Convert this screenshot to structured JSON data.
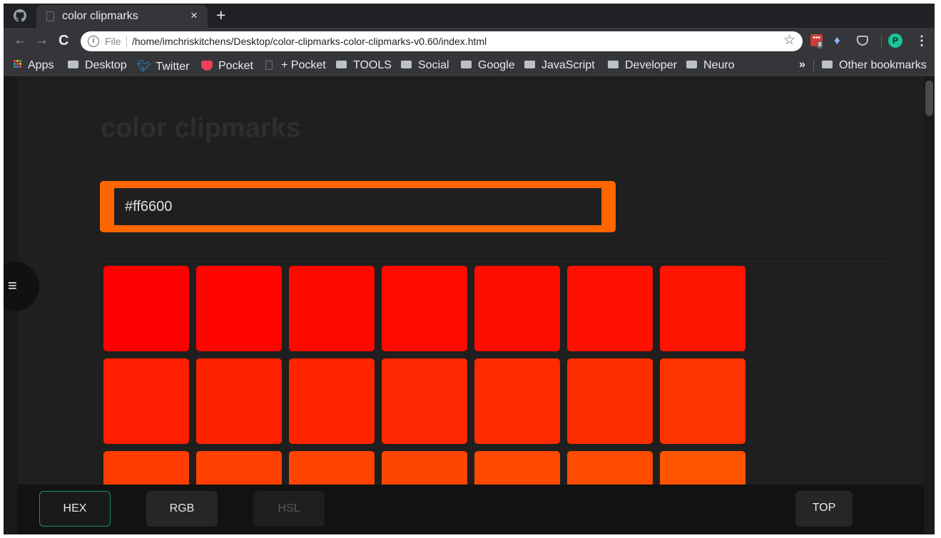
{
  "browser": {
    "tab_title": "color clipmarks",
    "tab_close": "×",
    "new_tab": "+",
    "url_scheme_label": "File",
    "url": "/home/imchriskitchens/Desktop/color-clipmarks-color-clipmarks-v0.60/index.html",
    "extension_badge": "8",
    "bookmarks": [
      {
        "label": "Apps",
        "icon": "apps-grid-icon"
      },
      {
        "label": "Desktop",
        "icon": "folder-icon"
      },
      {
        "label": "Twitter",
        "icon": "twitter-icon"
      },
      {
        "label": "Pocket",
        "icon": "pocket-icon"
      },
      {
        "label": "+ Pocket",
        "icon": "page-icon"
      },
      {
        "label": "TOOLS",
        "icon": "folder-icon"
      },
      {
        "label": "Social",
        "icon": "folder-icon"
      },
      {
        "label": "Google",
        "icon": "folder-icon"
      },
      {
        "label": "JavaScript",
        "icon": "folder-icon"
      },
      {
        "label": "Developer",
        "icon": "folder-icon"
      },
      {
        "label": "Neuro",
        "icon": "folder-icon"
      }
    ],
    "bookmarks_overflow": "»",
    "other_bookmarks": "Other bookmarks"
  },
  "page": {
    "title": "color clipmarks",
    "color_input_value": "#ff6600",
    "accent_color": "#ff6600",
    "swatch_rows": [
      [
        "#ff0000",
        "#ff0500",
        "#ff0800",
        "#ff0a00",
        "#ff0d00",
        "#ff1000",
        "#ff1400"
      ],
      [
        "#ff1f00",
        "#ff2200",
        "#ff2500",
        "#ff2800",
        "#ff2b00",
        "#ff2e00",
        "#ff3300"
      ],
      [
        "#ff3d00",
        "#ff4000",
        "#ff4300",
        "#ff4600",
        "#ff4900",
        "#ff4c00",
        "#ff5500"
      ]
    ],
    "menu_icon": "≡",
    "modes": [
      {
        "label": "HEX",
        "state": "active"
      },
      {
        "label": "RGB",
        "state": "normal"
      },
      {
        "label": "HSL",
        "state": "disabled"
      }
    ],
    "top_button": "TOP"
  }
}
